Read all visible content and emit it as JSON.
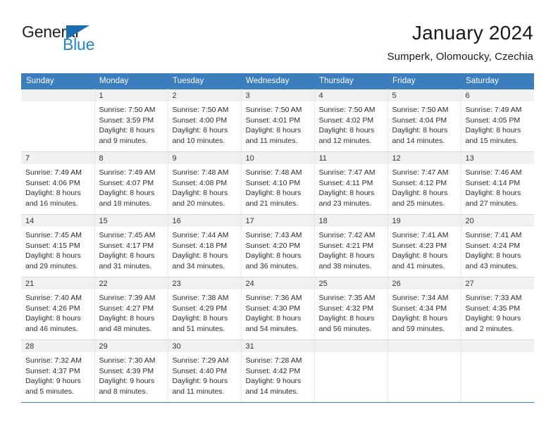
{
  "logo": {
    "word_top": "General",
    "word_bottom": "Blue",
    "triangle_icon": "triangle-icon",
    "color_dark": "#231f20",
    "color_blue": "#2185d0"
  },
  "header": {
    "title": "January 2024",
    "subtitle": "Sumperk, Olomoucky, Czechia"
  },
  "theme": {
    "header_blue": "#3b7dbd",
    "daynum_band": "#f1f1f1",
    "text": "#2c2c2c"
  },
  "calendar": {
    "weekday_headers": [
      "Sunday",
      "Monday",
      "Tuesday",
      "Wednesday",
      "Thursday",
      "Friday",
      "Saturday"
    ],
    "weeks": [
      [
        {
          "day": "",
          "lines": []
        },
        {
          "day": "1",
          "lines": [
            "Sunrise: 7:50 AM",
            "Sunset: 3:59 PM",
            "Daylight: 8 hours",
            "and 9 minutes."
          ]
        },
        {
          "day": "2",
          "lines": [
            "Sunrise: 7:50 AM",
            "Sunset: 4:00 PM",
            "Daylight: 8 hours",
            "and 10 minutes."
          ]
        },
        {
          "day": "3",
          "lines": [
            "Sunrise: 7:50 AM",
            "Sunset: 4:01 PM",
            "Daylight: 8 hours",
            "and 11 minutes."
          ]
        },
        {
          "day": "4",
          "lines": [
            "Sunrise: 7:50 AM",
            "Sunset: 4:02 PM",
            "Daylight: 8 hours",
            "and 12 minutes."
          ]
        },
        {
          "day": "5",
          "lines": [
            "Sunrise: 7:50 AM",
            "Sunset: 4:04 PM",
            "Daylight: 8 hours",
            "and 14 minutes."
          ]
        },
        {
          "day": "6",
          "lines": [
            "Sunrise: 7:49 AM",
            "Sunset: 4:05 PM",
            "Daylight: 8 hours",
            "and 15 minutes."
          ]
        }
      ],
      [
        {
          "day": "7",
          "lines": [
            "Sunrise: 7:49 AM",
            "Sunset: 4:06 PM",
            "Daylight: 8 hours",
            "and 16 minutes."
          ]
        },
        {
          "day": "8",
          "lines": [
            "Sunrise: 7:49 AM",
            "Sunset: 4:07 PM",
            "Daylight: 8 hours",
            "and 18 minutes."
          ]
        },
        {
          "day": "9",
          "lines": [
            "Sunrise: 7:48 AM",
            "Sunset: 4:08 PM",
            "Daylight: 8 hours",
            "and 20 minutes."
          ]
        },
        {
          "day": "10",
          "lines": [
            "Sunrise: 7:48 AM",
            "Sunset: 4:10 PM",
            "Daylight: 8 hours",
            "and 21 minutes."
          ]
        },
        {
          "day": "11",
          "lines": [
            "Sunrise: 7:47 AM",
            "Sunset: 4:11 PM",
            "Daylight: 8 hours",
            "and 23 minutes."
          ]
        },
        {
          "day": "12",
          "lines": [
            "Sunrise: 7:47 AM",
            "Sunset: 4:12 PM",
            "Daylight: 8 hours",
            "and 25 minutes."
          ]
        },
        {
          "day": "13",
          "lines": [
            "Sunrise: 7:46 AM",
            "Sunset: 4:14 PM",
            "Daylight: 8 hours",
            "and 27 minutes."
          ]
        }
      ],
      [
        {
          "day": "14",
          "lines": [
            "Sunrise: 7:45 AM",
            "Sunset: 4:15 PM",
            "Daylight: 8 hours",
            "and 29 minutes."
          ]
        },
        {
          "day": "15",
          "lines": [
            "Sunrise: 7:45 AM",
            "Sunset: 4:17 PM",
            "Daylight: 8 hours",
            "and 31 minutes."
          ]
        },
        {
          "day": "16",
          "lines": [
            "Sunrise: 7:44 AM",
            "Sunset: 4:18 PM",
            "Daylight: 8 hours",
            "and 34 minutes."
          ]
        },
        {
          "day": "17",
          "lines": [
            "Sunrise: 7:43 AM",
            "Sunset: 4:20 PM",
            "Daylight: 8 hours",
            "and 36 minutes."
          ]
        },
        {
          "day": "18",
          "lines": [
            "Sunrise: 7:42 AM",
            "Sunset: 4:21 PM",
            "Daylight: 8 hours",
            "and 38 minutes."
          ]
        },
        {
          "day": "19",
          "lines": [
            "Sunrise: 7:41 AM",
            "Sunset: 4:23 PM",
            "Daylight: 8 hours",
            "and 41 minutes."
          ]
        },
        {
          "day": "20",
          "lines": [
            "Sunrise: 7:41 AM",
            "Sunset: 4:24 PM",
            "Daylight: 8 hours",
            "and 43 minutes."
          ]
        }
      ],
      [
        {
          "day": "21",
          "lines": [
            "Sunrise: 7:40 AM",
            "Sunset: 4:26 PM",
            "Daylight: 8 hours",
            "and 46 minutes."
          ]
        },
        {
          "day": "22",
          "lines": [
            "Sunrise: 7:39 AM",
            "Sunset: 4:27 PM",
            "Daylight: 8 hours",
            "and 48 minutes."
          ]
        },
        {
          "day": "23",
          "lines": [
            "Sunrise: 7:38 AM",
            "Sunset: 4:29 PM",
            "Daylight: 8 hours",
            "and 51 minutes."
          ]
        },
        {
          "day": "24",
          "lines": [
            "Sunrise: 7:36 AM",
            "Sunset: 4:30 PM",
            "Daylight: 8 hours",
            "and 54 minutes."
          ]
        },
        {
          "day": "25",
          "lines": [
            "Sunrise: 7:35 AM",
            "Sunset: 4:32 PM",
            "Daylight: 8 hours",
            "and 56 minutes."
          ]
        },
        {
          "day": "26",
          "lines": [
            "Sunrise: 7:34 AM",
            "Sunset: 4:34 PM",
            "Daylight: 8 hours",
            "and 59 minutes."
          ]
        },
        {
          "day": "27",
          "lines": [
            "Sunrise: 7:33 AM",
            "Sunset: 4:35 PM",
            "Daylight: 9 hours",
            "and 2 minutes."
          ]
        }
      ],
      [
        {
          "day": "28",
          "lines": [
            "Sunrise: 7:32 AM",
            "Sunset: 4:37 PM",
            "Daylight: 9 hours",
            "and 5 minutes."
          ]
        },
        {
          "day": "29",
          "lines": [
            "Sunrise: 7:30 AM",
            "Sunset: 4:39 PM",
            "Daylight: 9 hours",
            "and 8 minutes."
          ]
        },
        {
          "day": "30",
          "lines": [
            "Sunrise: 7:29 AM",
            "Sunset: 4:40 PM",
            "Daylight: 9 hours",
            "and 11 minutes."
          ]
        },
        {
          "day": "31",
          "lines": [
            "Sunrise: 7:28 AM",
            "Sunset: 4:42 PM",
            "Daylight: 9 hours",
            "and 14 minutes."
          ]
        },
        {
          "day": "",
          "lines": []
        },
        {
          "day": "",
          "lines": []
        },
        {
          "day": "",
          "lines": []
        }
      ]
    ]
  }
}
